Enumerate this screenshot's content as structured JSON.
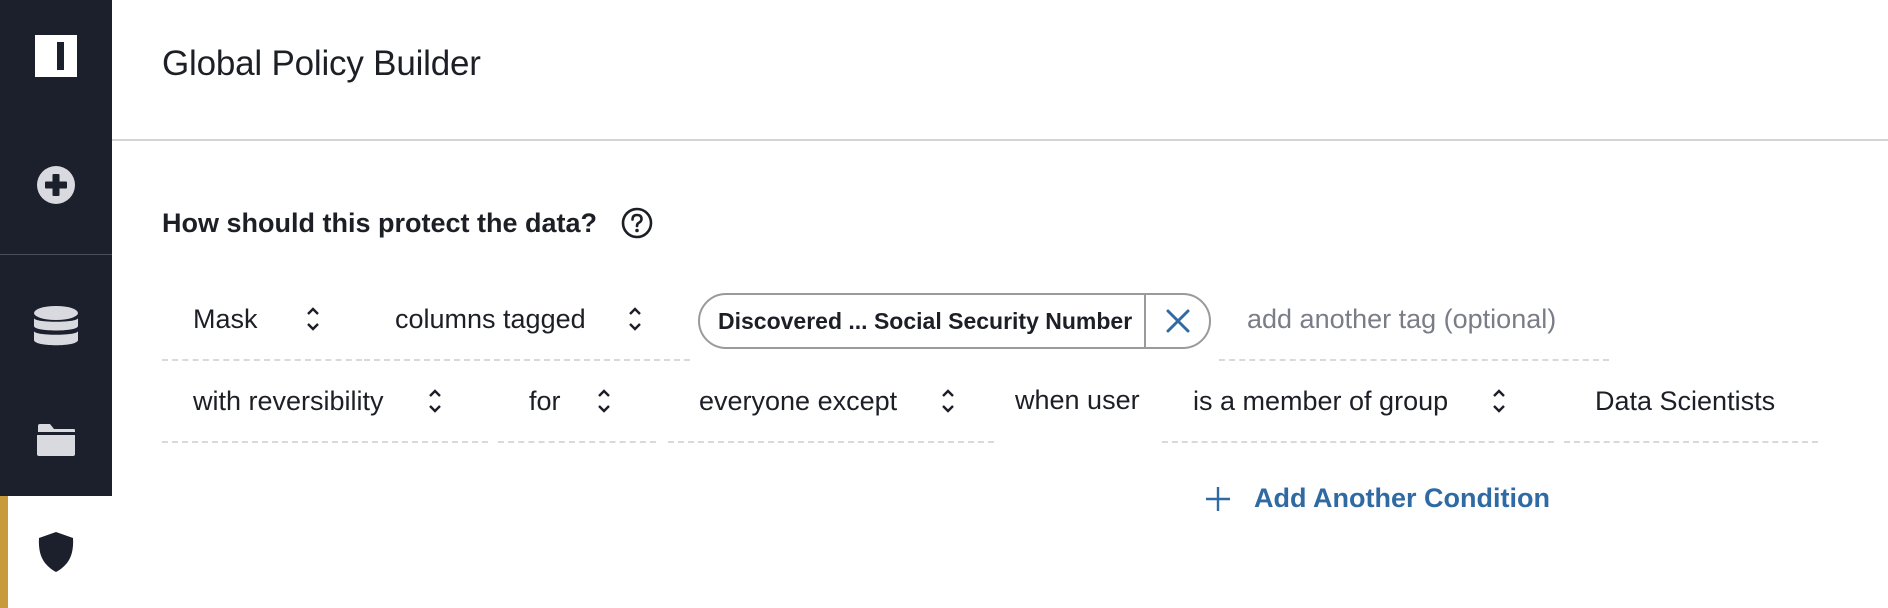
{
  "sidebar": {
    "items": [
      {
        "name": "logo",
        "icon": "logo-icon"
      },
      {
        "name": "add",
        "icon": "plus-circle-icon"
      },
      {
        "name": "data-sources",
        "icon": "database-icon"
      },
      {
        "name": "projects",
        "icon": "folder-icon"
      },
      {
        "name": "policies",
        "icon": "shield-icon",
        "active": true
      }
    ],
    "active_color": "#c99a3c",
    "background": "#1c1f2c"
  },
  "header": {
    "title": "Global Policy Builder"
  },
  "main": {
    "question": "How should this protect the data?",
    "help_icon": "question-circle-icon",
    "row1": {
      "action": "Mask",
      "target": "columns tagged",
      "tag_chip": "Discovered ... Social Security Number",
      "tag_input_placeholder": "add another tag (optional)",
      "tag_input_value": ""
    },
    "row2": {
      "reversibility": "with reversibility",
      "for": "for",
      "audience": "everyone except",
      "when_user": "when user",
      "condition": "is a member of group",
      "group": "Data Scientists"
    },
    "add_condition_label": "Add Another Condition",
    "accent_color": "#2f6aa3"
  }
}
